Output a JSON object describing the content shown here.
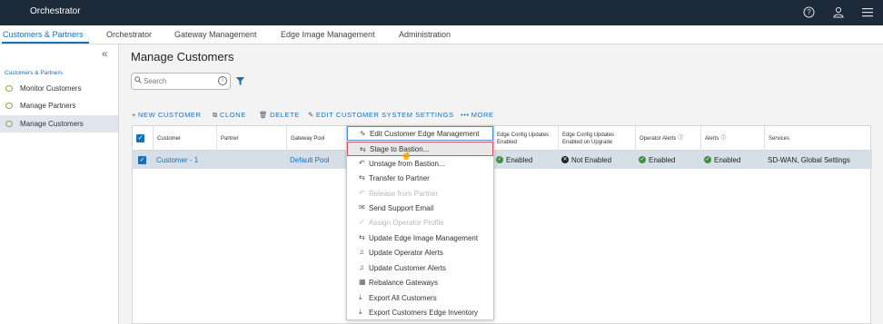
{
  "app": {
    "title": "Orchestrator"
  },
  "topnav": {
    "tabs": [
      "Customers & Partners",
      "Orchestrator",
      "Gateway Management",
      "Edge Image Management",
      "Administration"
    ]
  },
  "sidebar": {
    "section": "Customers & Partners",
    "items": [
      {
        "label": "Monitor Customers"
      },
      {
        "label": "Manage Partners"
      },
      {
        "label": "Manage Customers"
      }
    ]
  },
  "main": {
    "title": "Manage Customers",
    "search": {
      "placeholder": "Search"
    },
    "toolbar": {
      "new_customer": "NEW CUSTOMER",
      "clone": "CLONE",
      "delete": "DELETE",
      "edit_settings": "EDIT CUSTOMER SYSTEM SETTINGS",
      "more": "MORE"
    },
    "table": {
      "headers": {
        "customer": "Customer",
        "partner": "Partner",
        "gateway_pool": "Gateway Pool",
        "edge_config": "Edge Config Updates Enabled",
        "edge_config_upgrade": "Edge Config Updates Enabled on Upgrade",
        "operator_alerts": "Operator Alerts",
        "alerts": "Alerts",
        "services": "Services"
      },
      "row": {
        "customer": "Customer - 1",
        "partner": "",
        "gateway_pool": "Default Pool",
        "edge_config": "Enabled",
        "edge_config_upgrade": "Not Enabled",
        "operator_alerts": "Enabled",
        "alerts": "Enabled",
        "services": "SD-WAN, Global Settings"
      }
    }
  },
  "menu": {
    "items": [
      {
        "label": "Edit Customer Edge Management",
        "icon": "pencil-icon"
      },
      {
        "label": "Stage to Bastion...",
        "icon": "transfer-icon"
      },
      {
        "label": "Unstage from Bastion...",
        "icon": "undo-icon"
      },
      {
        "label": "Transfer to Partner",
        "icon": "transfer-icon"
      },
      {
        "label": "Release from Partner",
        "icon": "undo-icon"
      },
      {
        "label": "Send Support Email",
        "icon": "mail-icon"
      },
      {
        "label": "Assign Operator Profile",
        "icon": "check-icon"
      },
      {
        "label": "Update Edge Image Management",
        "icon": "transfer-icon"
      },
      {
        "label": "Update Operator Alerts",
        "icon": "bell-icon"
      },
      {
        "label": "Update Customer Alerts",
        "icon": "bell-icon"
      },
      {
        "label": "Rebalance Gateways",
        "icon": "grid-icon"
      },
      {
        "label": "Export All Customers",
        "icon": "download-icon"
      },
      {
        "label": "Export Customers Edge Inventory",
        "icon": "download-icon"
      }
    ]
  },
  "colors": {
    "accent": "#1b6fb5",
    "topbar": "#1d2a3a",
    "enabled": "#3f8f3f"
  }
}
